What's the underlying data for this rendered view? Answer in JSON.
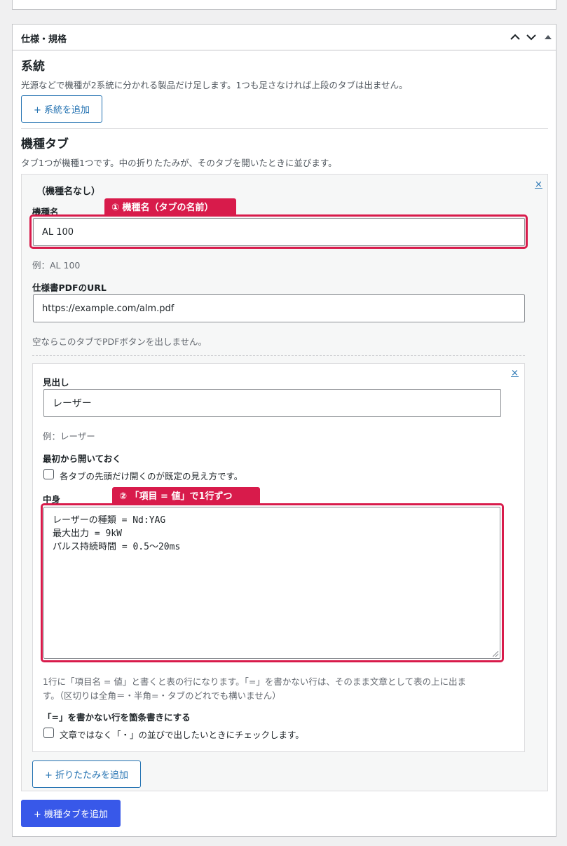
{
  "metabox": {
    "title": "仕様・規格",
    "controls": {
      "up": "▲",
      "down": "▼",
      "toggle": "▲"
    }
  },
  "systems": {
    "heading": "系統",
    "description": "光源などで機種が2系統に分かれる製品だけ足します。1つも足さなければ上段のタブは出ません。",
    "add_button": "+ 系統を追加"
  },
  "model_tabs": {
    "heading": "機種タブ",
    "description": "タブ1つが機種1つです。中の折りたたみが、そのタブを開いたときに並びます。",
    "add_button": "+ 機種タブを追加",
    "tab": {
      "title": "（機種名なし）",
      "remove": "×",
      "model_name": {
        "label": "機種名",
        "value": "AL 100",
        "hint": "例：AL 100",
        "callout": "① 機種名（タブの名前）"
      },
      "pdf_url": {
        "label": "仕様書PDFのURL",
        "value": "https://example.com/alm.pdf",
        "hint": "空ならこのタブでPDFボタンを出しません。"
      },
      "accordion": {
        "remove": "×",
        "heading_field": {
          "label": "見出し",
          "value": "レーザー",
          "hint": "例：レーザー"
        },
        "open_default": {
          "label": "最初から開いておく",
          "checkbox_text": "各タブの先頭だけ開くのが既定の見え方です。",
          "checked": false
        },
        "content": {
          "label": "中身",
          "callout": "② 「項目 = 値」で1行ずつ",
          "value": "レーザーの種類 = Nd:YAG\n最大出力 = 9kW\nパルス持続時間 = 0.5〜20ms",
          "hint_line1": "1行に「項目名 = 値」と書くと表の行になります。「=」を書かない行は、そのまま文章として表の上に出ま",
          "hint_line2": "す。（区切りは全角＝・半角=・タブのどれでも構いません）"
        },
        "bullet_option": {
          "label": "「=」を書かない行を箇条書きにする",
          "checkbox_text": "文章ではなく「・」の並びで出したいときにチェックします。",
          "checked": false
        }
      },
      "add_accordion_button": "+ 折りたたみを追加"
    }
  }
}
